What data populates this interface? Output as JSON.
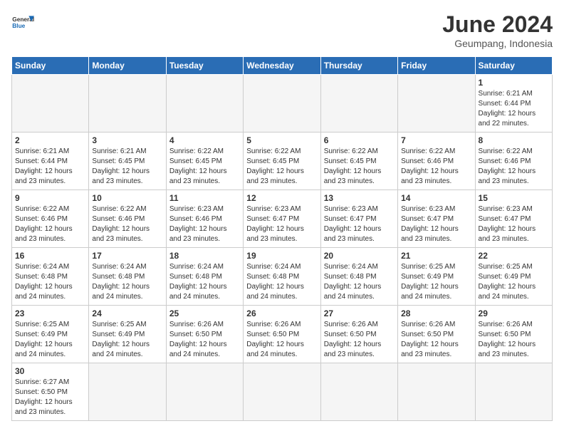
{
  "logo": {
    "general": "General",
    "blue": "Blue"
  },
  "header": {
    "month_year": "June 2024",
    "location": "Geumpang, Indonesia"
  },
  "weekdays": [
    "Sunday",
    "Monday",
    "Tuesday",
    "Wednesday",
    "Thursday",
    "Friday",
    "Saturday"
  ],
  "days": {
    "1": {
      "sunrise": "6:21 AM",
      "sunset": "6:44 PM",
      "daylight": "12 hours and 22 minutes."
    },
    "2": {
      "sunrise": "6:21 AM",
      "sunset": "6:44 PM",
      "daylight": "12 hours and 23 minutes."
    },
    "3": {
      "sunrise": "6:21 AM",
      "sunset": "6:45 PM",
      "daylight": "12 hours and 23 minutes."
    },
    "4": {
      "sunrise": "6:22 AM",
      "sunset": "6:45 PM",
      "daylight": "12 hours and 23 minutes."
    },
    "5": {
      "sunrise": "6:22 AM",
      "sunset": "6:45 PM",
      "daylight": "12 hours and 23 minutes."
    },
    "6": {
      "sunrise": "6:22 AM",
      "sunset": "6:45 PM",
      "daylight": "12 hours and 23 minutes."
    },
    "7": {
      "sunrise": "6:22 AM",
      "sunset": "6:46 PM",
      "daylight": "12 hours and 23 minutes."
    },
    "8": {
      "sunrise": "6:22 AM",
      "sunset": "6:46 PM",
      "daylight": "12 hours and 23 minutes."
    },
    "9": {
      "sunrise": "6:22 AM",
      "sunset": "6:46 PM",
      "daylight": "12 hours and 23 minutes."
    },
    "10": {
      "sunrise": "6:22 AM",
      "sunset": "6:46 PM",
      "daylight": "12 hours and 23 minutes."
    },
    "11": {
      "sunrise": "6:23 AM",
      "sunset": "6:46 PM",
      "daylight": "12 hours and 23 minutes."
    },
    "12": {
      "sunrise": "6:23 AM",
      "sunset": "6:47 PM",
      "daylight": "12 hours and 23 minutes."
    },
    "13": {
      "sunrise": "6:23 AM",
      "sunset": "6:47 PM",
      "daylight": "12 hours and 23 minutes."
    },
    "14": {
      "sunrise": "6:23 AM",
      "sunset": "6:47 PM",
      "daylight": "12 hours and 23 minutes."
    },
    "15": {
      "sunrise": "6:23 AM",
      "sunset": "6:47 PM",
      "daylight": "12 hours and 23 minutes."
    },
    "16": {
      "sunrise": "6:24 AM",
      "sunset": "6:48 PM",
      "daylight": "12 hours and 24 minutes."
    },
    "17": {
      "sunrise": "6:24 AM",
      "sunset": "6:48 PM",
      "daylight": "12 hours and 24 minutes."
    },
    "18": {
      "sunrise": "6:24 AM",
      "sunset": "6:48 PM",
      "daylight": "12 hours and 24 minutes."
    },
    "19": {
      "sunrise": "6:24 AM",
      "sunset": "6:48 PM",
      "daylight": "12 hours and 24 minutes."
    },
    "20": {
      "sunrise": "6:24 AM",
      "sunset": "6:48 PM",
      "daylight": "12 hours and 24 minutes."
    },
    "21": {
      "sunrise": "6:25 AM",
      "sunset": "6:49 PM",
      "daylight": "12 hours and 24 minutes."
    },
    "22": {
      "sunrise": "6:25 AM",
      "sunset": "6:49 PM",
      "daylight": "12 hours and 24 minutes."
    },
    "23": {
      "sunrise": "6:25 AM",
      "sunset": "6:49 PM",
      "daylight": "12 hours and 24 minutes."
    },
    "24": {
      "sunrise": "6:25 AM",
      "sunset": "6:49 PM",
      "daylight": "12 hours and 24 minutes."
    },
    "25": {
      "sunrise": "6:26 AM",
      "sunset": "6:50 PM",
      "daylight": "12 hours and 24 minutes."
    },
    "26": {
      "sunrise": "6:26 AM",
      "sunset": "6:50 PM",
      "daylight": "12 hours and 24 minutes."
    },
    "27": {
      "sunrise": "6:26 AM",
      "sunset": "6:50 PM",
      "daylight": "12 hours and 23 minutes."
    },
    "28": {
      "sunrise": "6:26 AM",
      "sunset": "6:50 PM",
      "daylight": "12 hours and 23 minutes."
    },
    "29": {
      "sunrise": "6:26 AM",
      "sunset": "6:50 PM",
      "daylight": "12 hours and 23 minutes."
    },
    "30": {
      "sunrise": "6:27 AM",
      "sunset": "6:50 PM",
      "daylight": "12 hours and 23 minutes."
    }
  }
}
